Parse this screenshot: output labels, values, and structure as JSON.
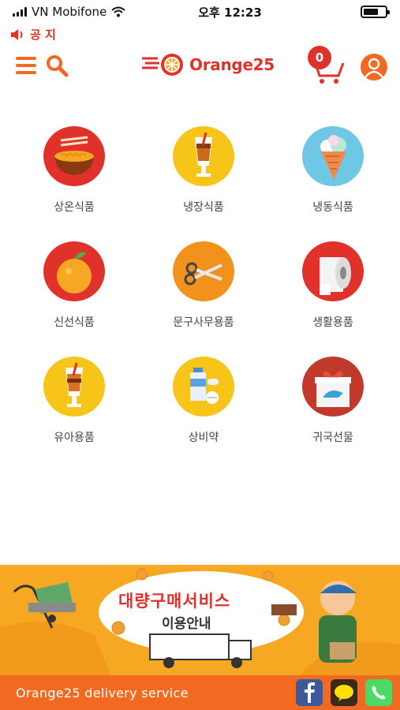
{
  "status_bar": {
    "carrier": "VN Mobifone",
    "time": "오후 12:23"
  },
  "notice": {
    "label": "공 지"
  },
  "header": {
    "logo_text": "Orange25",
    "cart_count": "0"
  },
  "categories": [
    {
      "label": "상온식품",
      "icon": "noodle-bowl-icon"
    },
    {
      "label": "냉장식품",
      "icon": "iced-drink-icon"
    },
    {
      "label": "냉동식품",
      "icon": "ice-cream-icon"
    },
    {
      "label": "신선식품",
      "icon": "orange-fruit-icon"
    },
    {
      "label": "문구사무용품",
      "icon": "scissors-icon"
    },
    {
      "label": "생활용품",
      "icon": "toilet-paper-icon"
    },
    {
      "label": "유아용품",
      "icon": "baby-drink-icon"
    },
    {
      "label": "상비약",
      "icon": "medicine-icon"
    },
    {
      "label": "귀국선물",
      "icon": "gift-box-icon"
    }
  ],
  "banner": {
    "title": "대량구매서비스",
    "subtitle": "이용안내"
  },
  "footer": {
    "text": "Orange25 delivery service"
  },
  "colors": {
    "brand_orange": "#f26a21",
    "brand_red": "#e0322a",
    "banner_yellow": "#f7a823"
  }
}
